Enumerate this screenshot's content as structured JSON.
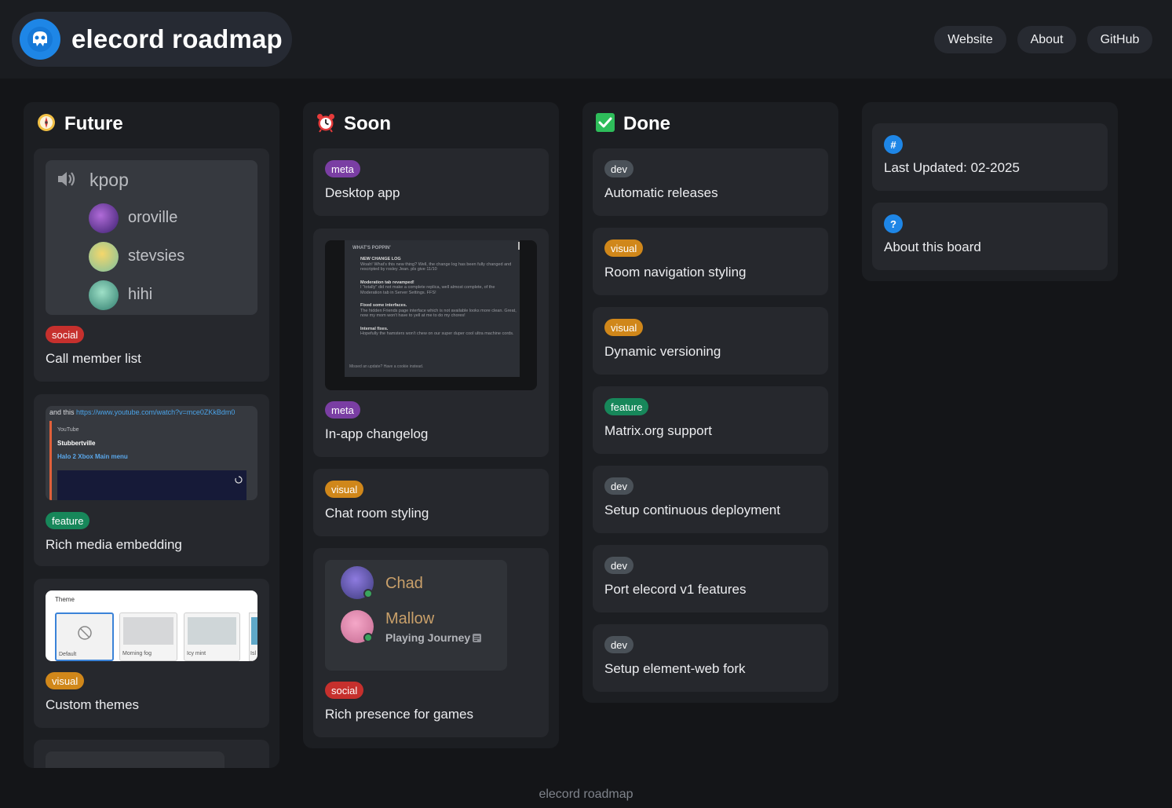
{
  "header": {
    "title": "elecord roadmap",
    "nav": [
      "Website",
      "About",
      "GitHub"
    ]
  },
  "columns": {
    "future": {
      "title": "Future",
      "cards": [
        {
          "tag": "social",
          "title": "Call member list"
        },
        {
          "tag": "feature",
          "title": "Rich media embedding"
        },
        {
          "tag": "visual",
          "title": "Custom themes"
        }
      ],
      "voice": {
        "channel": "kpop",
        "members": [
          "oroville",
          "stevsies",
          "hihi"
        ]
      },
      "embed": {
        "message_prefix": "and this",
        "link": "https://www.youtube.com/watch?v=mce0ZKkBdm0",
        "provider": "YouTube",
        "author": "Stubbertville",
        "video_title": "Halo 2 Xbox Main menu"
      },
      "theme_picker": {
        "label": "Theme",
        "options": [
          "Default",
          "Morning fog",
          "Icy mint",
          "Isl"
        ]
      }
    },
    "soon": {
      "title": "Soon",
      "cards": [
        {
          "tag": "meta",
          "title": "Desktop app"
        },
        {
          "tag": "meta",
          "title": "In-app changelog"
        },
        {
          "tag": "visual",
          "title": "Chat room styling"
        },
        {
          "tag": "social",
          "title": "Rich presence for games"
        }
      ],
      "changelog": {
        "heading": "WHAT'S POPPIN'",
        "items": [
          {
            "title": "NEW CHANGE LOG",
            "body": "Woah! What's this new thing? Well, the change log has been fully changed and rescripted by rosley Jean. pls give 11/10"
          },
          {
            "title": "Moderation tab revamped!",
            "body": "I \"totally\" did not make a complete replica, well almost complete, of the Moderation tab in Server Settings. FFS!"
          },
          {
            "title": "Fixed some interfaces.",
            "body": "The hidden Friends page interface which is not available looks more clean. Great, now my mom won't have to yell at me to do my chores!"
          },
          {
            "title": "Internal fixes.",
            "body": "Hopefully the hamsters won't chew on our super duper cool ultra machine cords."
          }
        ],
        "footer": "Missed an update? Have a cookie instead."
      },
      "presence": {
        "users": [
          {
            "name": "Chad",
            "activity": ""
          },
          {
            "name": "Mallow",
            "activity": "Playing Journey"
          }
        ]
      }
    },
    "done": {
      "title": "Done",
      "cards": [
        {
          "tag": "dev",
          "title": "Automatic releases"
        },
        {
          "tag": "visual",
          "title": "Room navigation styling"
        },
        {
          "tag": "visual",
          "title": "Dynamic versioning"
        },
        {
          "tag": "feature",
          "title": "Matrix.org support"
        },
        {
          "tag": "dev",
          "title": "Setup continuous deployment"
        },
        {
          "tag": "dev",
          "title": "Port elecord v1 features"
        },
        {
          "tag": "dev",
          "title": "Setup element-web fork"
        }
      ]
    },
    "info": {
      "cards": [
        {
          "icon": "#",
          "title": "Last Updated: 02-2025"
        },
        {
          "icon": "?",
          "title": "About this board"
        }
      ]
    }
  },
  "footer": "elecord roadmap",
  "colors": {
    "background": "#141518",
    "card": "#26282d",
    "accent": "#1e86e6"
  }
}
